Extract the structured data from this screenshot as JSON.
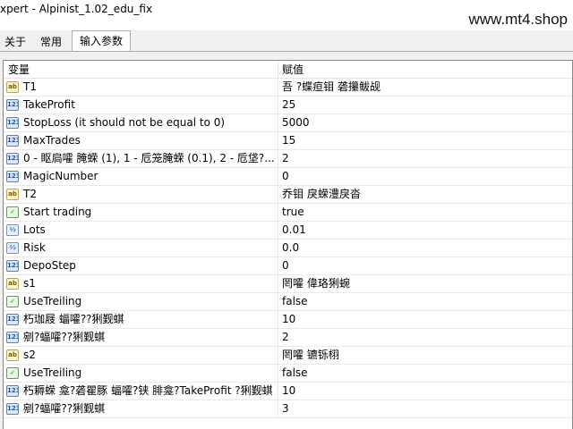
{
  "window": {
    "title": "xpert - Alpinist_1.02_edu_fix",
    "watermark": "www.mt4.shop"
  },
  "tabs": [
    {
      "label": "关于"
    },
    {
      "label": "常用"
    },
    {
      "label": "输入参数"
    }
  ],
  "table": {
    "columns": [
      "变量",
      "赋值"
    ],
    "rows": [
      {
        "name": "T1",
        "value": "吾   ?蝶疸钼     砻攥鲅觇",
        "icon": "string-icon"
      },
      {
        "name": "TakeProfit",
        "value": "25",
        "icon": "integer-icon"
      },
      {
        "name": "StopLoss (it should not be equal to 0)",
        "value": "5000",
        "icon": "integer-icon"
      },
      {
        "name": "MaxTrades",
        "value": "15",
        "icon": "integer-icon"
      },
      {
        "name": "0 - 眍扃嚯        腌蝾 (1), 1 - 卮笼腌蝾 (0.1), 2 - 卮垡?...",
        "value": "2",
        "icon": "integer-icon"
      },
      {
        "name": "MagicNumber",
        "value": "0",
        "icon": "integer-icon"
      },
      {
        "name": "T2",
        "value": "乔钼 戾蝾澧戾沓",
        "icon": "string-icon"
      },
      {
        "name": "Start trading",
        "value": "true",
        "icon": "bool-icon"
      },
      {
        "name": "Lots",
        "value": "0.01",
        "icon": "double-icon"
      },
      {
        "name": "Risk",
        "value": "0.0",
        "icon": "double-icon"
      },
      {
        "name": "DepoStep",
        "value": "0",
        "icon": "integer-icon"
      },
      {
        "name": "s1",
        "value": "罔嚯 偉珞猁蜿",
        "icon": "string-icon"
      },
      {
        "name": "UseTreiling",
        "value": "false",
        "icon": "bool-icon"
      },
      {
        "name": "朽珈屐 蝠嚯??猁觐蜞",
        "value": "10",
        "icon": "integer-icon"
      },
      {
        "name": "剜?蝠嚯??猁觐蜞",
        "value": "2",
        "icon": "integer-icon"
      },
      {
        "name": "s2",
        "value": "罔嚯 镳铄栩",
        "icon": "string-icon"
      },
      {
        "name": "UseTreiling",
        "value": "false",
        "icon": "bool-icon"
      },
      {
        "name": "朽耨蝾   龛?砻瞿豚 蝠嚯?铗 腓龛?TakeProfit ?猁觐蜞",
        "value": "10",
        "icon": "integer-icon"
      },
      {
        "name": "剜?蝠嚯??猁觐蜞",
        "value": "3",
        "icon": "integer-icon"
      }
    ]
  }
}
